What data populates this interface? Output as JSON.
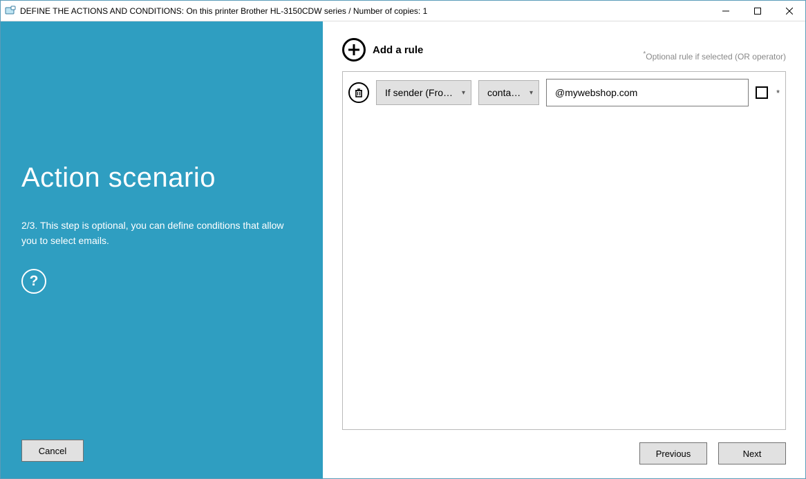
{
  "window": {
    "title": "DEFINE THE ACTIONS AND CONDITIONS: On this printer Brother HL-3150CDW series / Number of copies: 1"
  },
  "sidebar": {
    "heading": "Action scenario",
    "description": "2/3. This step is optional, you can define conditions that allow you to select emails.",
    "help_symbol": "?",
    "cancel_label": "Cancel"
  },
  "header": {
    "add_rule_label": "Add a rule",
    "optional_note_prefix": "*",
    "optional_note": "Optional rule if selected (OR operator)"
  },
  "rules": [
    {
      "field_label": "If sender (From)...",
      "operator_label": "contains",
      "value": "@mywebshop.com",
      "optional_checked": false
    }
  ],
  "footer": {
    "previous_label": "Previous",
    "next_label": "Next"
  }
}
